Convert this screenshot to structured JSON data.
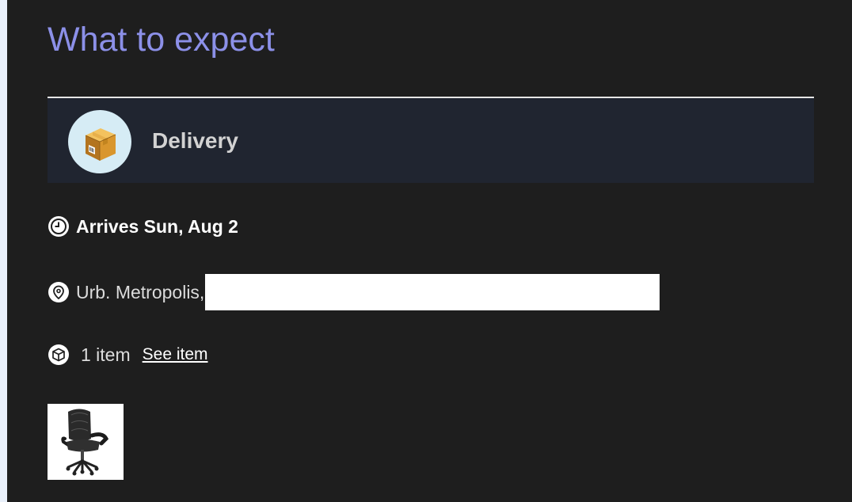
{
  "header": {
    "title": "What to expect"
  },
  "delivery": {
    "label": "Delivery",
    "icon": "package-box-icon"
  },
  "details": {
    "arrival_text": "Arrives Sun, Aug 2",
    "address_text": "Urb. Metropolis,",
    "item_count_text": "1 item",
    "see_item_label": "See item"
  },
  "product": {
    "thumbnail": "office-chair-image"
  },
  "colors": {
    "background": "#1e1e1e",
    "title": "#8c90e8",
    "delivery_band": "#202530",
    "icon_circle": "#d6ecf5"
  }
}
